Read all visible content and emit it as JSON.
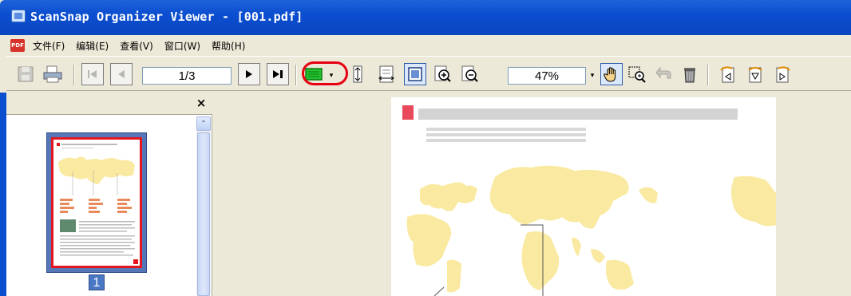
{
  "window": {
    "title": "ScanSnap Organizer Viewer - [001.pdf]",
    "app_icon": "scansnap-viewer-icon"
  },
  "menubar": {
    "pdf_icon_label": "PDF",
    "items": [
      {
        "label": "文件(F)"
      },
      {
        "label": "编辑(E)"
      },
      {
        "label": "查看(V)"
      },
      {
        "label": "窗口(W)"
      },
      {
        "label": "帮助(H)"
      }
    ]
  },
  "toolbar": {
    "page_field": "1/3",
    "zoom_field": "47%",
    "highlight_color": "#e60012",
    "green_button_color": "#22c32e"
  },
  "thumbnail_panel": {
    "close_label": "×",
    "scroll_up_glyph": "⌃",
    "pages": [
      {
        "number": "1"
      }
    ]
  },
  "colors": {
    "title_bar": "#0a47c1",
    "map_yellow": "#fae9a0",
    "accent_red": "#e4171e"
  }
}
